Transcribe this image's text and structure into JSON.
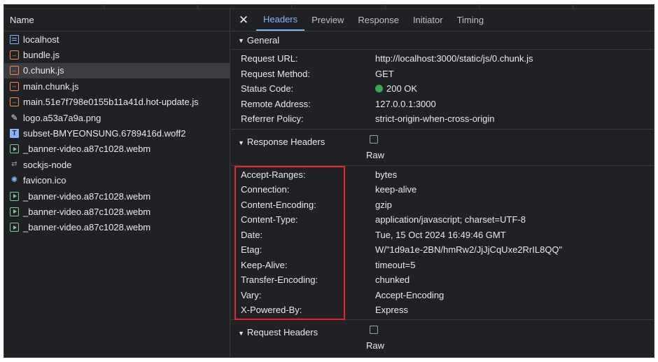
{
  "network": {
    "column_header": "Name",
    "requests": [
      {
        "name": "localhost",
        "icon": "document-icon",
        "selected": false
      },
      {
        "name": "bundle.js",
        "icon": "script-icon",
        "selected": false
      },
      {
        "name": "0.chunk.js",
        "icon": "script-icon",
        "selected": true
      },
      {
        "name": "main.chunk.js",
        "icon": "script-icon",
        "selected": false
      },
      {
        "name": "main.51e7f798e0155b11a41d.hot-update.js",
        "icon": "script-icon",
        "selected": false
      },
      {
        "name": "logo.a53a7a9a.png",
        "icon": "image-icon",
        "selected": false
      },
      {
        "name": "subset-BMYEONSUNG.6789416d.woff2",
        "icon": "font-icon",
        "selected": false
      },
      {
        "name": "_banner-video.a87c1028.webm",
        "icon": "media-icon",
        "selected": false
      },
      {
        "name": "sockjs-node",
        "icon": "websocket-icon",
        "selected": false
      },
      {
        "name": "favicon.ico",
        "icon": "favicon-icon",
        "selected": false
      },
      {
        "name": "_banner-video.a87c1028.webm",
        "icon": "media-icon",
        "selected": false
      },
      {
        "name": "_banner-video.a87c1028.webm",
        "icon": "media-icon",
        "selected": false
      },
      {
        "name": "_banner-video.a87c1028.webm",
        "icon": "media-icon",
        "selected": false
      }
    ]
  },
  "tabs": {
    "close": "✕",
    "items": [
      "Headers",
      "Preview",
      "Response",
      "Initiator",
      "Timing"
    ],
    "active": "Headers"
  },
  "general": {
    "title": "General",
    "rows": [
      {
        "key": "Request URL:",
        "value": "http://localhost:3000/static/js/0.chunk.js"
      },
      {
        "key": "Request Method:",
        "value": "GET"
      },
      {
        "key": "Status Code:",
        "value": "200 OK"
      },
      {
        "key": "Remote Address:",
        "value": "127.0.0.1:3000"
      },
      {
        "key": "Referrer Policy:",
        "value": "strict-origin-when-cross-origin"
      }
    ]
  },
  "response_headers": {
    "title": "Response Headers",
    "raw_label": "Raw",
    "rows": [
      {
        "key": "Accept-Ranges:",
        "value": "bytes"
      },
      {
        "key": "Connection:",
        "value": "keep-alive"
      },
      {
        "key": "Content-Encoding:",
        "value": "gzip"
      },
      {
        "key": "Content-Type:",
        "value": "application/javascript; charset=UTF-8"
      },
      {
        "key": "Date:",
        "value": "Tue, 15 Oct 2024 16:49:46 GMT"
      },
      {
        "key": "Etag:",
        "value": "W/\"1d9a1e-2BN/hmRw2/JjJjCqUxe2RrIL8QQ\""
      },
      {
        "key": "Keep-Alive:",
        "value": "timeout=5"
      },
      {
        "key": "Transfer-Encoding:",
        "value": "chunked"
      },
      {
        "key": "Vary:",
        "value": "Accept-Encoding"
      },
      {
        "key": "X-Powered-By:",
        "value": "Express"
      }
    ]
  },
  "request_headers": {
    "title": "Request Headers",
    "raw_label": "Raw"
  },
  "colors": {
    "accent": "#8ab4f8",
    "status_ok": "#34a853",
    "highlight_box": "#e8262b"
  }
}
